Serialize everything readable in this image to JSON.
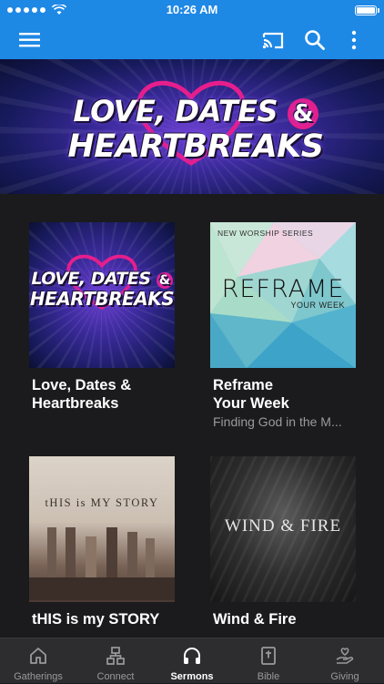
{
  "status_bar": {
    "time": "10:26 AM"
  },
  "app_bar": {
    "icons": [
      "menu-icon",
      "cast-icon",
      "search-icon",
      "more-vert-icon"
    ]
  },
  "hero": {
    "logo_line1": "LOVE, DATES",
    "logo_amp": "&",
    "logo_line2": "HEARTBREAKS"
  },
  "series": [
    {
      "title": "Love, Dates & Heartbreaks",
      "subtitle": "",
      "art": {
        "line1": "LOVE, DATES",
        "amp": "&",
        "line2": "HEARTBREAKS"
      }
    },
    {
      "title": "Reframe Your Week",
      "subtitle": "Finding God in the M...",
      "art": {
        "tag": "NEW WORSHIP SERIES",
        "main": "REFRAME",
        "sub": "YOUR WEEK"
      }
    },
    {
      "title": "tHIS is my STORY",
      "subtitle": "",
      "art": {
        "main": "tHIS is MY STORY"
      }
    },
    {
      "title": "Wind & Fire",
      "subtitle": "",
      "art": {
        "main": "WIND & FIRE"
      }
    }
  ],
  "tabs": [
    {
      "label": "Gatherings",
      "icon": "home-icon",
      "active": false
    },
    {
      "label": "Connect",
      "icon": "connect-icon",
      "active": false
    },
    {
      "label": "Sermons",
      "icon": "headphones-icon",
      "active": true
    },
    {
      "label": "Bible",
      "icon": "bible-icon",
      "active": false
    },
    {
      "label": "Giving",
      "icon": "giving-icon",
      "active": false
    }
  ],
  "colors": {
    "brand": "#1e88e5",
    "background": "#1b1b1d",
    "tabbar": "#2d2d30",
    "accent_pink": "#e61e8c"
  }
}
